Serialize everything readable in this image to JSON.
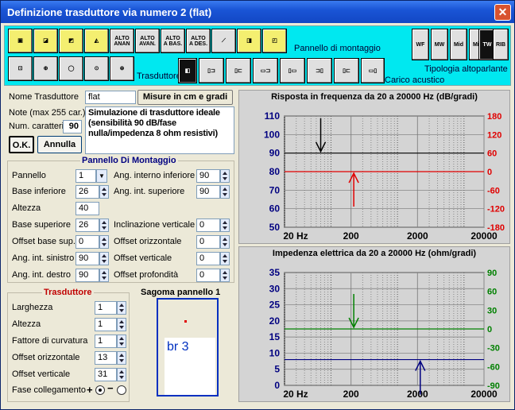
{
  "window": {
    "title": "Definizione trasduttore via numero 2 (flat)",
    "close": "✕"
  },
  "toolbar": {
    "mount_label": "Pannello di montaggio",
    "transducer_label": "Trasduttore",
    "load_label": "Carico acustico",
    "type_label": "Tipologia altoparlante",
    "mount_buttons": [
      "",
      "",
      "",
      "",
      "ALTO\nANAN",
      "ALTO\nAVAN.",
      "ALTO\nA BAS.",
      "ALTO\nA DES.",
      "",
      "",
      ""
    ],
    "type_buttons": [
      "WF",
      "MW",
      "Mid",
      "Mid",
      "TW",
      "RIB"
    ]
  },
  "form": {
    "name_label": "Nome Trasduttore",
    "name_value": "flat",
    "units_button": "Misure in cm e gradi",
    "notes_label": "Note (max 255 car.)",
    "chars_label": "Num. caratteri",
    "chars_value": "90",
    "notes_text": "Simulazione di trasduttore ideale (sensibilità 90 dB/fase nulla/impedenza 8 ohm resistivi)",
    "ok": "O.K.",
    "cancel": "Annulla"
  },
  "panel": {
    "title": "Pannello Di Montaggio",
    "left": [
      {
        "label": "Pannello",
        "value": "1"
      },
      {
        "label": "Base inferiore",
        "value": "26"
      },
      {
        "label": "Altezza",
        "value": "40"
      },
      {
        "label": "Base superiore",
        "value": "26"
      },
      {
        "label": "Offset base sup.",
        "value": "0"
      },
      {
        "label": "Ang. int. sinistro",
        "value": "90"
      },
      {
        "label": "Ang. int. destro",
        "value": "90"
      }
    ],
    "right": [
      {
        "label": "Ang. interno inferiore",
        "value": "90"
      },
      {
        "label": "Ang. int. superiore",
        "value": "90"
      },
      {
        "label": "Inclinazione verticale",
        "value": "0"
      },
      {
        "label": "Offset orizzontale",
        "value": "0"
      },
      {
        "label": "Offset verticale",
        "value": "0"
      },
      {
        "label": "Offset profondità",
        "value": "0"
      }
    ]
  },
  "transducer": {
    "title": "Trasduttore",
    "rows": [
      {
        "label": "Larghezza",
        "value": "1"
      },
      {
        "label": "Altezza",
        "value": "1"
      },
      {
        "label": "Fattore di curvatura",
        "value": "1"
      },
      {
        "label": "Offset orizzontale",
        "value": "13"
      },
      {
        "label": "Offset verticale",
        "value": "31"
      }
    ],
    "phase_label": "Fase collegamento",
    "phase_plus": "+",
    "phase_minus": "−"
  },
  "shape": {
    "title": "Sagoma pannello 1",
    "label": "br 3"
  },
  "colors": {
    "accent": "#00e8f0",
    "left_axis": "#000080",
    "phase": "#e00000",
    "imp_phase": "#008000"
  },
  "chart_data": [
    {
      "type": "line",
      "title": "Risposta in frequenza da 20 a 20000 Hz (dB/gradi)",
      "x_scale": "log",
      "xlim": [
        20,
        20000
      ],
      "x_ticks": [
        "20 Hz",
        "200",
        "2000",
        "20000"
      ],
      "ylim": [
        50,
        110
      ],
      "y_ticks": [
        "110",
        "100",
        "90",
        "80",
        "70",
        "60",
        "50"
      ],
      "y2lim": [
        -180,
        180
      ],
      "y2_ticks": [
        "180",
        "120",
        "60",
        "0",
        "-60",
        "-120",
        "-180"
      ],
      "series": [
        {
          "axis": "left",
          "color": "#000000",
          "x": [
            20,
            20000
          ],
          "y": [
            90,
            90
          ]
        },
        {
          "axis": "right",
          "color": "#e00000",
          "x": [
            20,
            20000
          ],
          "y": [
            0,
            0
          ]
        }
      ],
      "markers": [
        {
          "axis": "left",
          "color": "#000000",
          "x": 70,
          "direction": "down"
        },
        {
          "axis": "right",
          "color": "#e00000",
          "x": 220,
          "direction": "up"
        }
      ],
      "grid": true
    },
    {
      "type": "line",
      "title": "Impedenza elettrica da 20 a 20000 Hz (ohm/gradi)",
      "x_scale": "log",
      "xlim": [
        20,
        20000
      ],
      "x_ticks": [
        "20 Hz",
        "200",
        "2000",
        "20000"
      ],
      "ylim": [
        0,
        35
      ],
      "y_ticks": [
        "35",
        "30",
        "25",
        "20",
        "15",
        "10",
        "5",
        "0"
      ],
      "y2lim": [
        -90,
        90
      ],
      "y2_ticks": [
        "90",
        "60",
        "30",
        "0",
        "-30",
        "-60",
        "-90"
      ],
      "series": [
        {
          "axis": "left",
          "color": "#000080",
          "x": [
            20,
            20000
          ],
          "y": [
            8,
            8
          ]
        },
        {
          "axis": "right",
          "color": "#008000",
          "x": [
            20,
            20000
          ],
          "y": [
            0,
            0
          ]
        }
      ],
      "markers": [
        {
          "axis": "right",
          "color": "#008000",
          "x": 220,
          "direction": "down"
        },
        {
          "axis": "left",
          "color": "#000080",
          "x": 2200,
          "direction": "up"
        }
      ],
      "grid": true
    }
  ]
}
